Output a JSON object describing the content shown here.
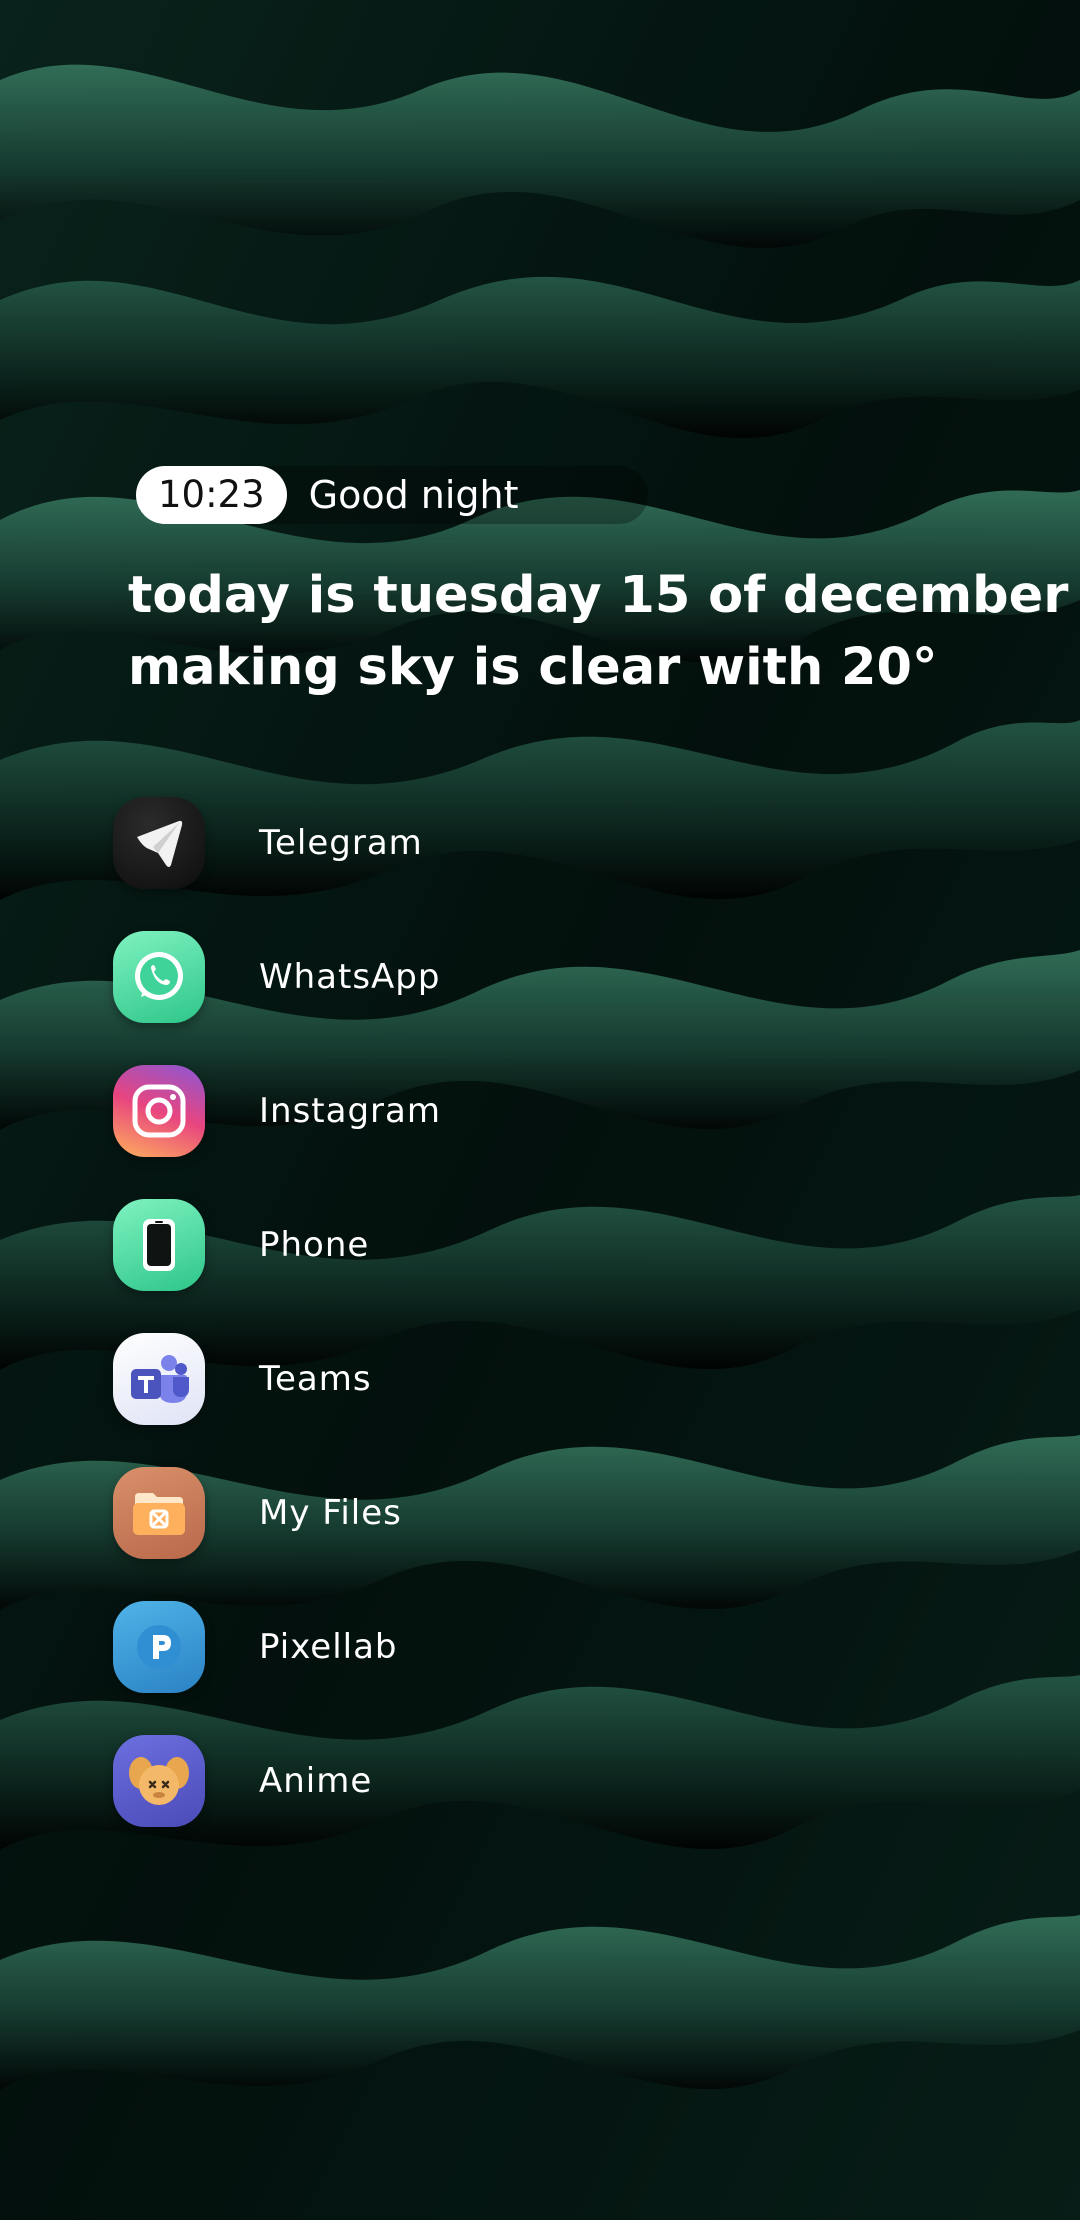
{
  "header": {
    "time": "10:23",
    "greeting": "Good night"
  },
  "headline": {
    "line1": "today is tuesday 15 of december",
    "line2": "making sky is clear with 20°"
  },
  "apps": [
    {
      "label": "Telegram",
      "icon": "telegram-icon"
    },
    {
      "label": "WhatsApp",
      "icon": "whatsapp-icon"
    },
    {
      "label": "Instagram",
      "icon": "instagram-icon"
    },
    {
      "label": "Phone",
      "icon": "phone-icon"
    },
    {
      "label": "Teams",
      "icon": "teams-icon"
    },
    {
      "label": "My Files",
      "icon": "my-files-icon"
    },
    {
      "label": "Pixellab",
      "icon": "pixellab-icon"
    },
    {
      "label": "Anime",
      "icon": "anime-icon"
    }
  ],
  "colors": {
    "wallpaper_dark": "#020605",
    "wallpaper_green": "#2f6d58",
    "clock_pill": "#ffffff",
    "text": "#ffffff"
  }
}
